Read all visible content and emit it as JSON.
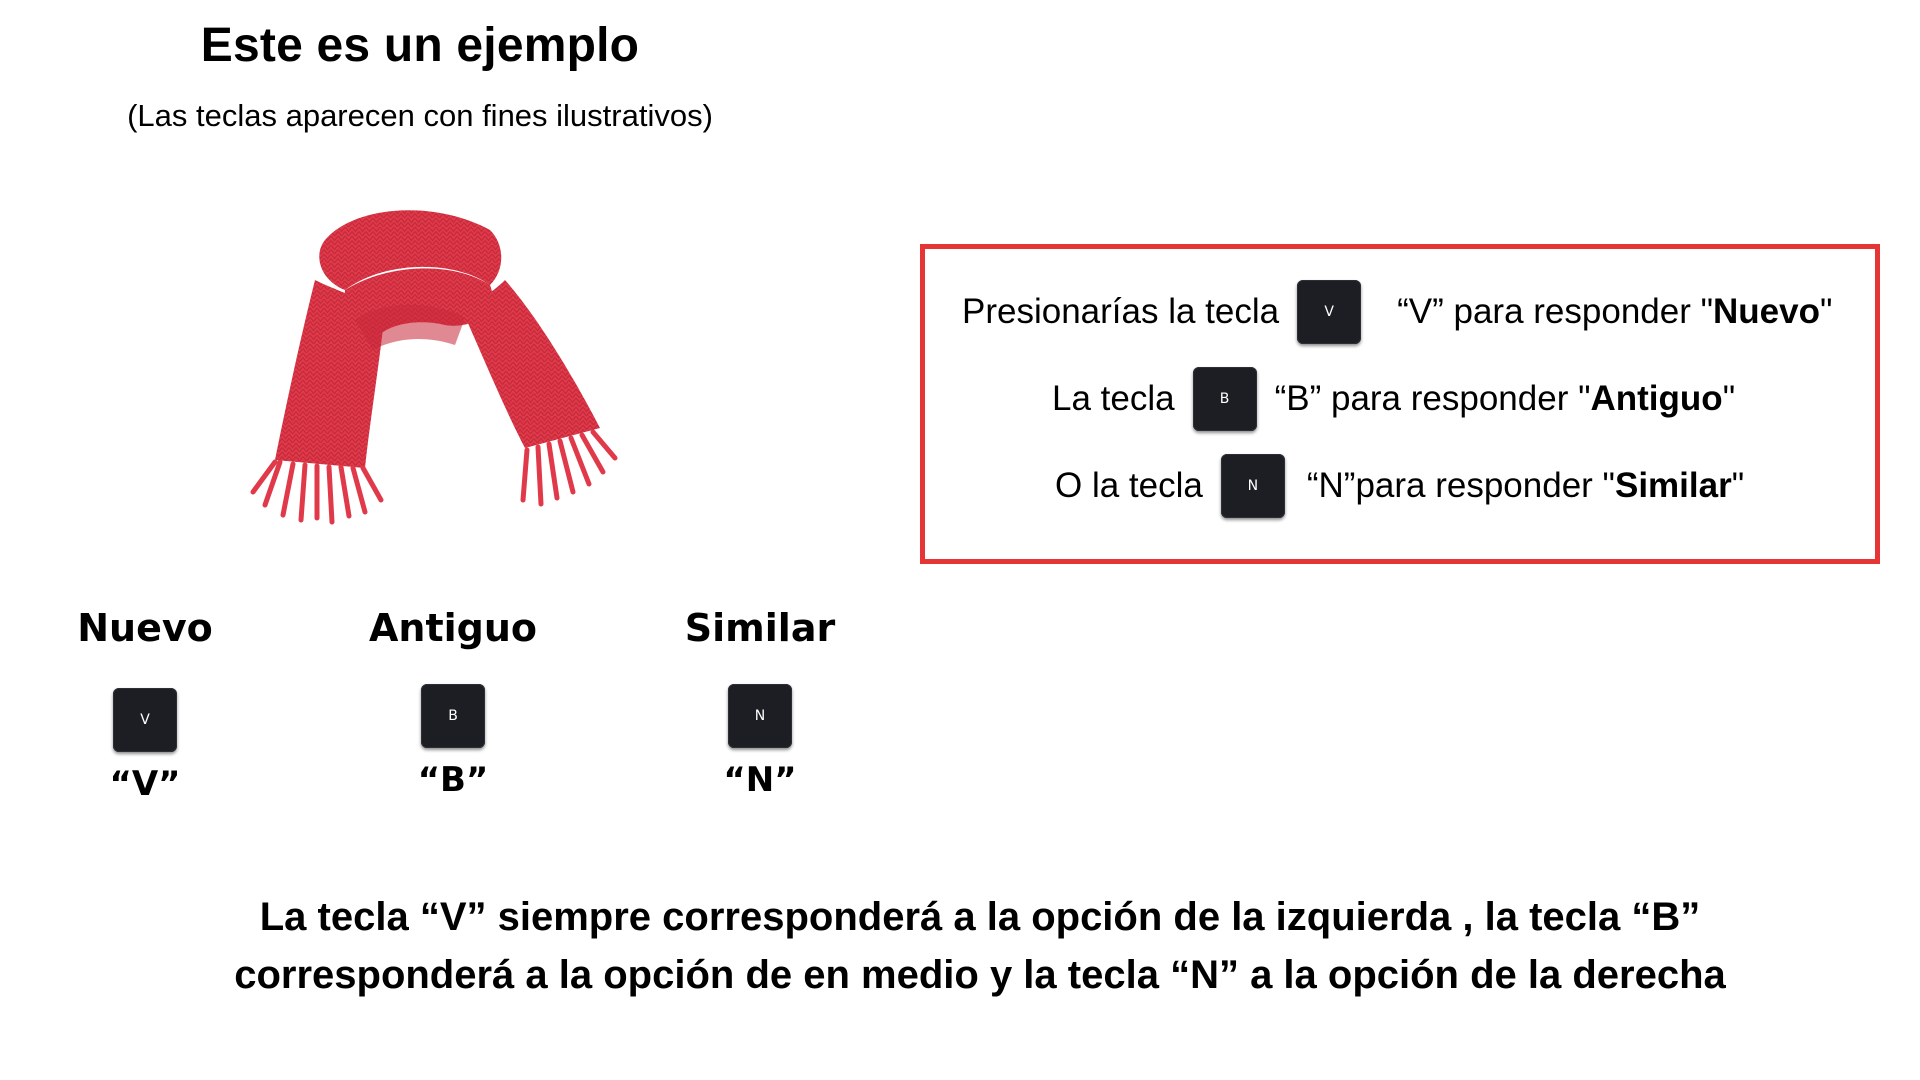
{
  "header": {
    "title": "Este es un ejemplo",
    "subtitle": "(Las teclas aparecen con fines ilustrativos)"
  },
  "image": {
    "icon": "red-scarf-image"
  },
  "instructions": {
    "border_color": "#e53535",
    "rows": [
      {
        "before": "Presionarías la tecla",
        "key": "V",
        "after": "“V” para responder \"",
        "answer": "Nuevo",
        "close": "\""
      },
      {
        "before": "La tecla",
        "key": "B",
        "after": "“B” para responder \"",
        "answer": "Antiguo",
        "close": "\""
      },
      {
        "before": "O la tecla",
        "key": "N",
        "after": "“N”para responder \"",
        "answer": "Similar",
        "close": "\""
      }
    ]
  },
  "options": [
    {
      "label": "Nuevo",
      "key": "V",
      "quote": "“V”"
    },
    {
      "label": "Antiguo",
      "key": "B",
      "quote": "“B”"
    },
    {
      "label": "Similar",
      "key": "N",
      "quote": "“N”"
    }
  ],
  "footer": {
    "line1": "La tecla “V” siempre corresponderá a la opción de la izquierda , la tecla “B”",
    "line2": "corresponderá a la opción de en medio y la tecla “N” a la opción de la derecha"
  },
  "colors": {
    "key_bg": "#1c1e23",
    "scarf": "#e23a4c"
  }
}
